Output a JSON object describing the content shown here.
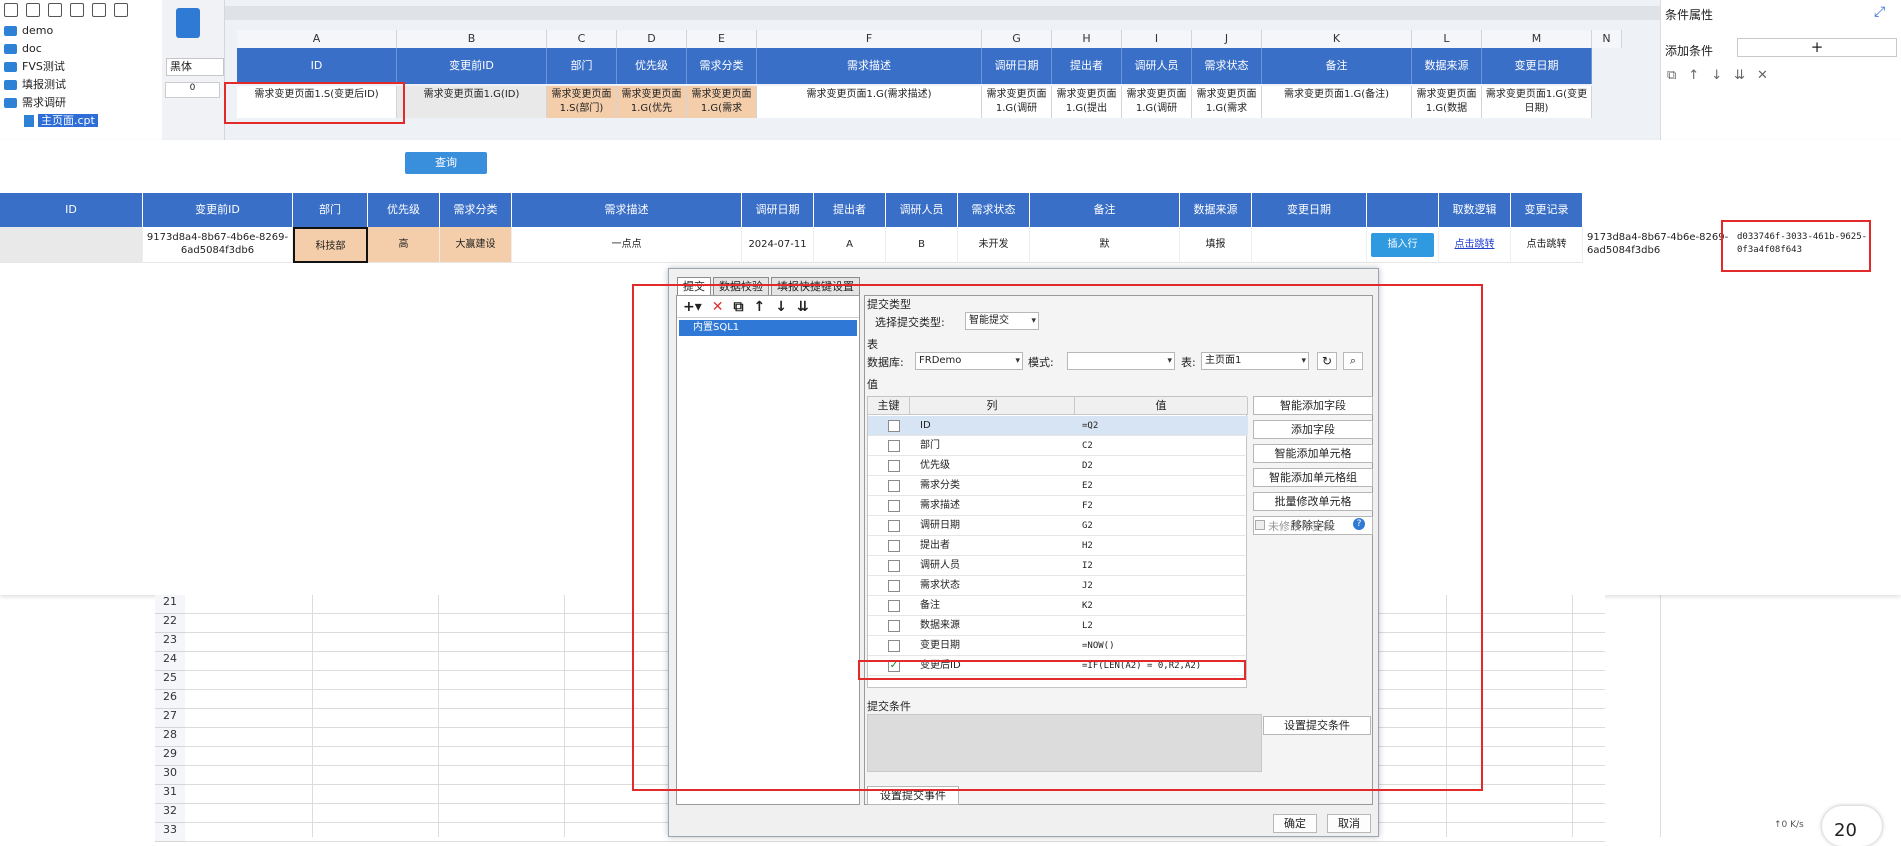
{
  "tree": {
    "items": [
      "demo",
      "doc",
      "FVS测试",
      "填报测试",
      "需求调研"
    ],
    "selected_file": "主页面.cpt"
  },
  "designer": {
    "font_name": "黑体",
    "row_zero_label": "0",
    "columns": [
      "A",
      "B",
      "C",
      "D",
      "E",
      "F",
      "G",
      "H",
      "I",
      "J",
      "K",
      "L",
      "M",
      "N"
    ],
    "header_cells": [
      "ID",
      "变更前ID",
      "部门",
      "优先级",
      "需求分类",
      "需求描述",
      "调研日期",
      "提出者",
      "调研人员",
      "需求状态",
      "备注",
      "数据来源",
      "变更日期"
    ],
    "row_cells": [
      "需求变更页面1.S(变更后ID)",
      "需求变更页面1.G(ID)",
      "需求变更页面1.S(部门)",
      "需求变更页面1.G(优先",
      "需求变更页面1.G(需求",
      "需求变更页面1.G(需求描述)",
      "需求变更页面1.G(调研",
      "需求变更页面1.G(提出",
      "需求变更页面1.G(调研",
      "需求变更页面1.G(需求",
      "需求变更页面1.G(备注)",
      "需求变更页面1.G(数据",
      "需求变更页面1.G(变更日期)"
    ]
  },
  "right_panel": {
    "title": "条件属性",
    "add_condition": "添加条件",
    "add_symbol": "+"
  },
  "preview": {
    "query_button": "查询",
    "headers": [
      "ID",
      "变更前ID",
      "部门",
      "优先级",
      "需求分类",
      "需求描述",
      "调研日期",
      "提出者",
      "调研人员",
      "需求状态",
      "备注",
      "数据来源",
      "变更日期",
      "",
      "取数逻辑",
      "变更记录"
    ],
    "row": {
      "prev_id": "9173d8a4-8b67-4b6e-8269-6ad5084f3db6",
      "dept": "科技部",
      "priority": "高",
      "category": "大赢建设",
      "desc": "一点点",
      "date": "2024-07-11",
      "proposer": "A",
      "researcher": "B",
      "status": "未开发",
      "note": "默",
      "source": "填报",
      "insert_row": "插入行",
      "logic_link": "点击跳转",
      "record": "点击跳转",
      "extra_id": "9173d8a4-8b67-4b6e-8269-6ad5084f3db6",
      "new_id": "d033746f-3033-461b-9625-0f3a4f08f643"
    }
  },
  "sheet": {
    "rows": [
      "21",
      "22",
      "23",
      "24",
      "25",
      "26",
      "27",
      "28",
      "29",
      "30",
      "31",
      "32",
      "33"
    ]
  },
  "dialog": {
    "tabs": [
      "提交",
      "数据校验",
      "填报快捷键设置"
    ],
    "source_item": "内置SQL1",
    "submit_type_title": "提交类型",
    "select_submit_type_label": "选择提交类型:",
    "submit_type_value": "智能提交",
    "table_section": "表",
    "db_label": "数据库:",
    "db_value": "FRDemo",
    "schema_label": "模式:",
    "schema_value": "",
    "table_label": "表:",
    "table_value": "主页面1",
    "value_section": "值",
    "table_headers": [
      "主键",
      "列",
      "值"
    ],
    "fields": [
      {
        "col": "ID",
        "val": "=Q2",
        "checked": ""
      },
      {
        "col": "部门",
        "val": "C2",
        "checked": ""
      },
      {
        "col": "优先级",
        "val": "D2",
        "checked": ""
      },
      {
        "col": "需求分类",
        "val": "E2",
        "checked": ""
      },
      {
        "col": "需求描述",
        "val": "F2",
        "checked": ""
      },
      {
        "col": "调研日期",
        "val": "G2",
        "checked": ""
      },
      {
        "col": "提出者",
        "val": "H2",
        "checked": ""
      },
      {
        "col": "调研人员",
        "val": "I2",
        "checked": ""
      },
      {
        "col": "需求状态",
        "val": "J2",
        "checked": ""
      },
      {
        "col": "备注",
        "val": "K2",
        "checked": ""
      },
      {
        "col": "数据来源",
        "val": "L2",
        "checked": ""
      },
      {
        "col": "变更日期",
        "val": "=NOW()",
        "checked": ""
      },
      {
        "col": "变更后ID",
        "val": "=IF(LEN(A2) = 0,R2,A2)",
        "checked": "✓"
      }
    ],
    "side_buttons": [
      "智能添加字段",
      "添加字段",
      "智能添加单元格",
      "智能添加单元格组",
      "批量修改单元格",
      "移除字段"
    ],
    "no_update_label": "未修改不更新",
    "submit_condition_title": "提交条件",
    "set_condition_button": "设置提交条件",
    "set_event_button": "设置提交事件",
    "ok_button": "确定",
    "cancel_button": "取消"
  },
  "status": {
    "net": "↑0 K/s",
    "clock": "20"
  }
}
